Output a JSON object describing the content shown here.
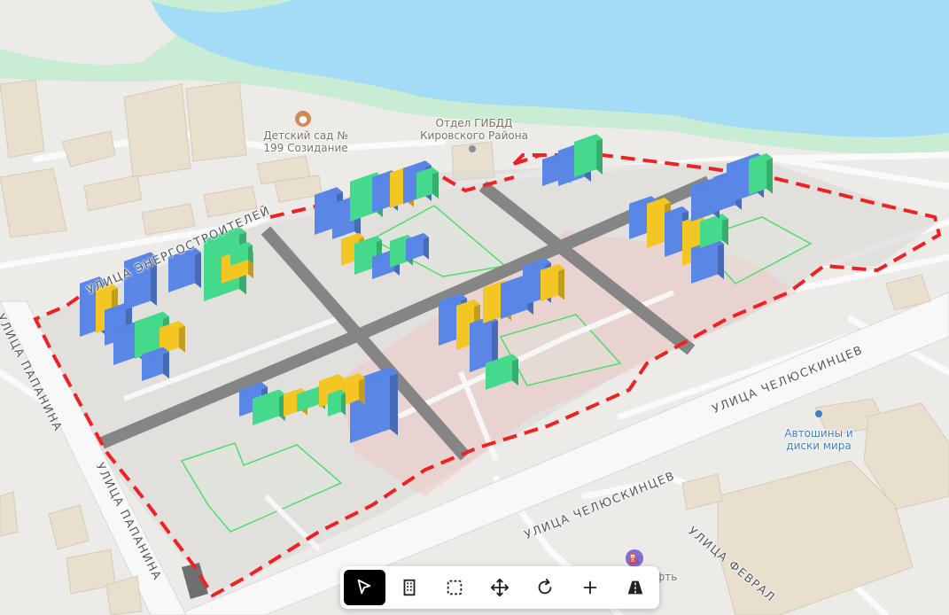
{
  "map": {
    "pois": [
      {
        "name": "kindergarten",
        "label": "Детский сад №\n199 Созидание",
        "icon": "kindergarten-icon",
        "color": "#d08a55"
      },
      {
        "name": "gibdd",
        "label": "Отдел ГИБДД\nКировского Района",
        "icon": "dot-icon",
        "color": "#8a8f97"
      },
      {
        "name": "tires",
        "label": "Автошины и\nдиски мира",
        "icon": "dot-icon",
        "color": "#3f7fc7"
      },
      {
        "name": "gas",
        "label": "фть",
        "icon": "gas-station-icon",
        "color": "#7b6fd6"
      }
    ],
    "streets": [
      {
        "name": "energostroiteley",
        "label": "УЛИЦА ЭНЕРГОСТРОИТЕЛЕЙ"
      },
      {
        "name": "chelyuskintsev-1",
        "label": "УЛИЦА ЧЕЛЮСКИНЦЕВ"
      },
      {
        "name": "chelyuskintsev-2",
        "label": "УЛИЦА ЧЕЛЮСКИНЦЕВ"
      },
      {
        "name": "papanina-1",
        "label": "УЛИЦА ПАПАНИНА"
      },
      {
        "name": "papanina-2",
        "label": "УЛИЦА ПАПАНИНА"
      },
      {
        "name": "fevralskaya",
        "label": "УЛИЦА ФЕВРАЛ"
      }
    ],
    "colors": {
      "water": "#a4dcf6",
      "park": "#c8ecd4",
      "ground": "#ecebe8",
      "boundary": "#ee2222",
      "road": "#8b8b8b",
      "building_blue": "#5a86e6",
      "building_green": "#45d98c",
      "building_yellow": "#f3c623"
    }
  },
  "toolbar": {
    "tools": [
      {
        "name": "select-tool",
        "icon": "cursor-arrow-icon",
        "active": true
      },
      {
        "name": "building-tool",
        "icon": "building-icon",
        "active": false
      },
      {
        "name": "area-select-tool",
        "icon": "dashed-square-icon",
        "active": false
      },
      {
        "name": "move-tool",
        "icon": "move-arrows-icon",
        "active": false
      },
      {
        "name": "rotate-tool",
        "icon": "rotate-icon",
        "active": false
      },
      {
        "name": "add-tool",
        "icon": "plus-icon",
        "active": false
      },
      {
        "name": "road-tool",
        "icon": "road-icon",
        "active": false
      }
    ]
  }
}
